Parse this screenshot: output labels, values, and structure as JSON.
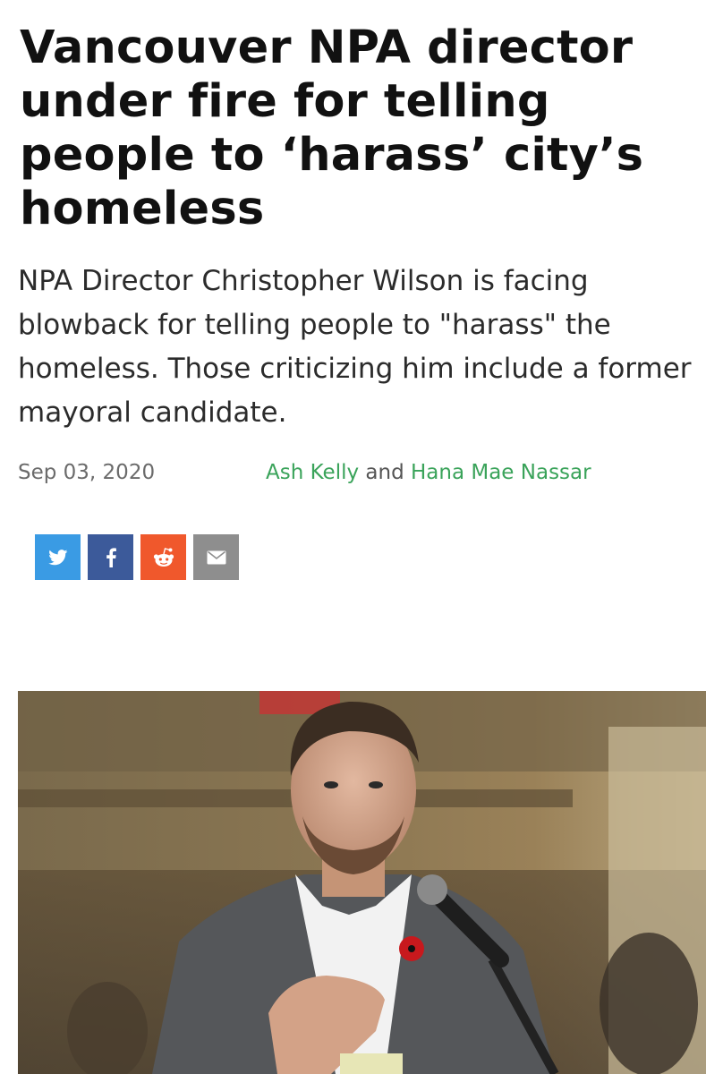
{
  "article": {
    "headline": "Vancouver NPA director under fire for telling people to ‘harass’ city’s homeless",
    "dek": "NPA Director Christopher Wilson is facing blowback for telling people to \"harass\" the homeless. Those criticizing him include a former mayoral candidate.",
    "date": "Sep 03, 2020",
    "authors": [
      "Ash Kelly",
      "Hana Mae Nassar"
    ],
    "author_joiner": "and"
  },
  "share": [
    {
      "icon": "twitter-icon",
      "color": "#3a9be4"
    },
    {
      "icon": "facebook-icon",
      "color": "#3c5a9a"
    },
    {
      "icon": "reddit-icon",
      "color": "#f0582c"
    },
    {
      "icon": "email-icon",
      "color": "#8e8e8e"
    }
  ],
  "colors": {
    "author_link": "#3aa35a",
    "headline": "#111111"
  }
}
